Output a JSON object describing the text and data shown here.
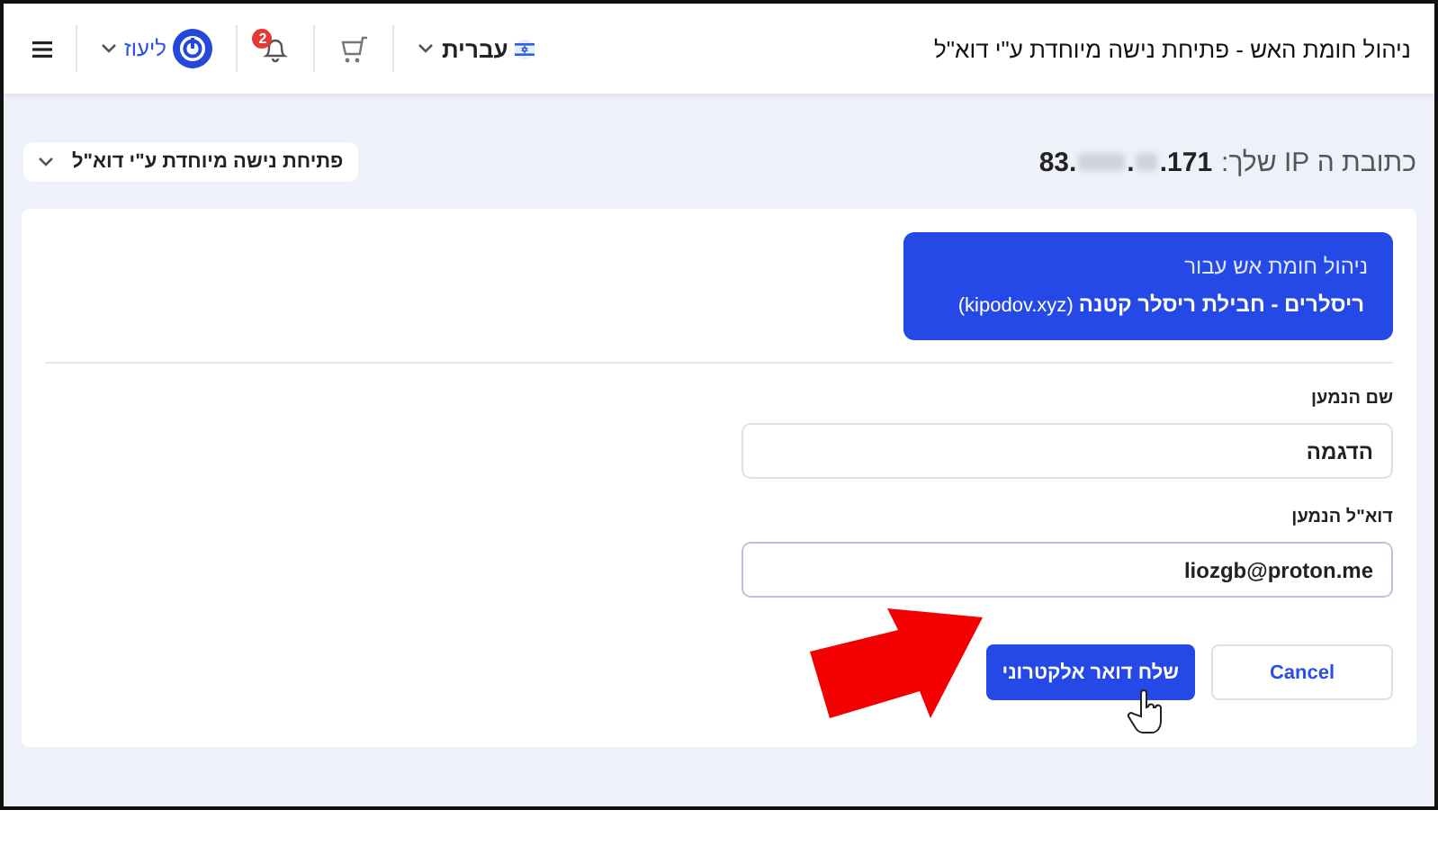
{
  "header": {
    "title": "ניהול חומת האש - פתיחת נישה מיוחדת ע\"י דוא\"ל",
    "language": {
      "label": "עברית"
    },
    "notifications": {
      "count": "2"
    },
    "user": {
      "name": "ליעוז"
    }
  },
  "access_menu": {
    "label": "פתיחת נישה מיוחדת ע\"י דוא\"ל"
  },
  "ip": {
    "label": "כתובת ה IP שלך:",
    "first_octet": "83.",
    "middle_dot": ".",
    "last_octet": ".171"
  },
  "product": {
    "caption": "ניהול חומת אש עבור",
    "name": "**ריסלרים - חבילת ריסלר קטנה** (kipodov.xyz)"
  },
  "fields": [
    {
      "label": "שם הנמען",
      "value": "הדגמה"
    },
    {
      "label": "דוא\"ל הנמען",
      "value": "liozgb@proton.me"
    }
  ],
  "buttons": [
    {
      "kind": "secondary",
      "label": "Cancel"
    },
    {
      "kind": "primary",
      "label": "שלח דואר אלקטרוני"
    }
  ]
}
